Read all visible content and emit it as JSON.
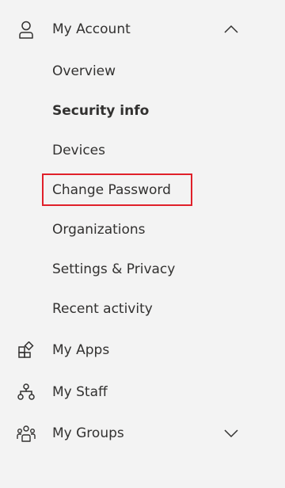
{
  "nav": {
    "my_account": {
      "label": "My Account",
      "icon": "person-icon",
      "expanded": true,
      "chevron": "chevron-up-icon",
      "children": [
        {
          "label": "Overview",
          "active": false
        },
        {
          "label": "Security info",
          "active": true
        },
        {
          "label": "Devices",
          "active": false
        },
        {
          "label": "Change Password",
          "active": false,
          "highlighted": true
        },
        {
          "label": "Organizations",
          "active": false
        },
        {
          "label": "Settings & Privacy",
          "active": false
        },
        {
          "label": "Recent activity",
          "active": false
        }
      ]
    },
    "my_apps": {
      "label": "My Apps",
      "icon": "apps-icon"
    },
    "my_staff": {
      "label": "My Staff",
      "icon": "staff-hierarchy-icon"
    },
    "my_groups": {
      "label": "My Groups",
      "icon": "groups-icon",
      "expanded": false,
      "chevron": "chevron-down-icon"
    }
  },
  "colors": {
    "background": "#f3f3f3",
    "text": "#323130",
    "highlight_border": "#e0202a"
  }
}
